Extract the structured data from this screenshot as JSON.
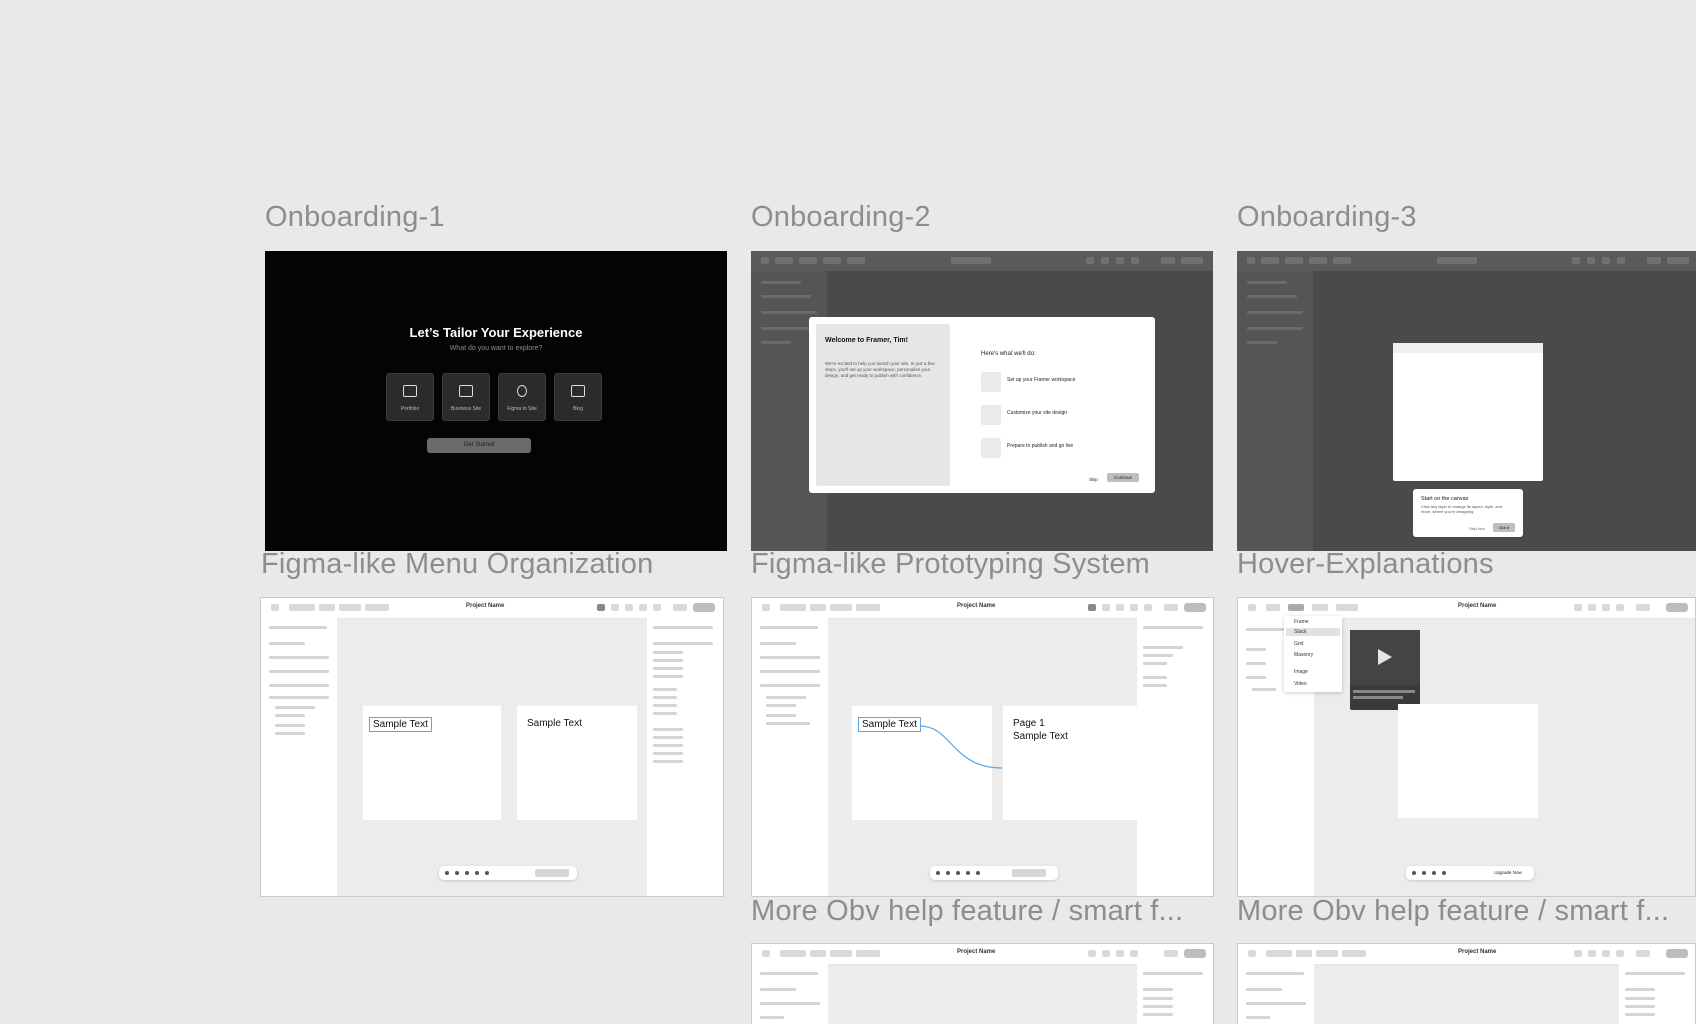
{
  "frames": {
    "onboarding_1": {
      "title": "Onboarding-1",
      "heading": "Let’s Tailor Your Experience",
      "subheading": "What do you want to explore?",
      "options": [
        "Portfolio",
        "Business Site",
        "Figma to Site",
        "Blog"
      ],
      "cta": "Get Started"
    },
    "onboarding_2": {
      "title": "Onboarding-2",
      "welcome": "Welcome to Framer, Tim!",
      "welcome_body": "We're excited to help you launch your site. In just a few steps, you'll set up your workspace, personalize your design, and get ready to publish with confidence.",
      "list_heading": "Here's what we'll do:",
      "steps": [
        "Set up your Framer workspace",
        "Customize your site design",
        "Prepare to publish and go live"
      ],
      "skip": "Skip",
      "continue": "Continue"
    },
    "onboarding_3": {
      "title": "Onboarding-3",
      "tip_title": "Start on the canvas",
      "tip_body": "Click any layer to change its layout, style, and more, where you're designing.",
      "tip_skip": "Skip tour",
      "tip_next": "Got it"
    },
    "menu_org": {
      "title": "Figma-like Menu Organization",
      "project": "Project Name",
      "sample_1": "Sample Text",
      "sample_2": "Sample Text"
    },
    "prototyping": {
      "title": "Figma-like Prototyping System",
      "project": "Project Name",
      "sample": "Sample Text",
      "page_label": "Page 1",
      "page_sample": "Sample Text"
    },
    "hover": {
      "title": "Hover-Explanations",
      "project": "Project Name",
      "menu_items": [
        "Frame",
        "Stack",
        "Grid",
        "Masonry",
        "Image",
        "Video"
      ],
      "upgrade": "Upgrade Now"
    },
    "more_1": {
      "title": "More Obv help feature / smart f...",
      "project": "Project Name"
    },
    "more_2": {
      "title": "More Obv help feature / smart f...",
      "project": "Project Name"
    }
  }
}
